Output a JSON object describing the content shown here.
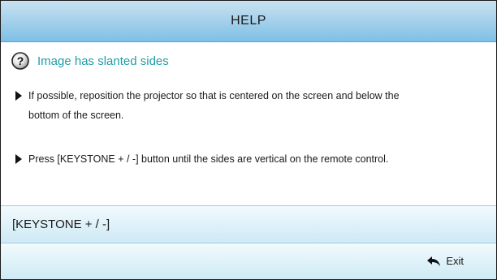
{
  "header": {
    "title": "HELP"
  },
  "topic": {
    "icon": "help-question-icon",
    "title": "Image has slanted sides",
    "color": "#1e9ea8"
  },
  "bullets": [
    {
      "text": "If possible, reposition the projector so that is centered on the screen and below the bottom of the screen."
    },
    {
      "text": "Press [KEYSTONE + / -] button until the sides are vertical on the remote control."
    }
  ],
  "keystone": {
    "label": "[KEYSTONE + / -]"
  },
  "footer": {
    "exit_icon": "return-arrow-icon",
    "exit_label": "Exit"
  },
  "colors": {
    "header_band": "#a8d2ec",
    "row_band": "#ddf1f9"
  }
}
